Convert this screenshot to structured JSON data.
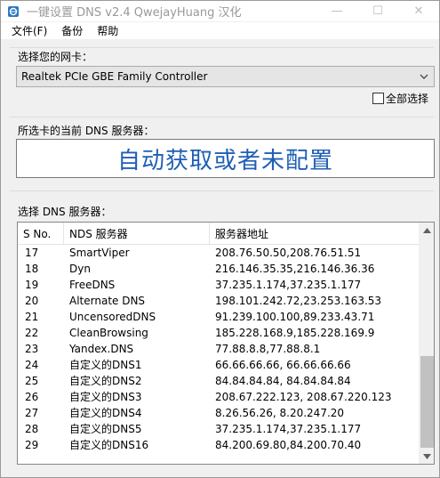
{
  "window": {
    "title": "一键设置 DNS v2.4 QwejayHuang 汉化",
    "controls": {
      "minimize": "—",
      "maximize": "☐",
      "close": "✕"
    }
  },
  "menu": [
    "文件(F)",
    "备份",
    "帮助"
  ],
  "adapter": {
    "label": "选择您的网卡：",
    "selected": "Realtek PCIe GBE Family Controller",
    "select_all": "全部选择"
  },
  "current_dns": {
    "label": "所选卡的当前 DNS 服务器：",
    "value": "自动获取或者未配置"
  },
  "dns_list": {
    "label": "选择 DNS 服务器：",
    "columns": [
      "S No.",
      "NDS 服务器",
      "服务器地址"
    ],
    "rows": [
      [
        "17",
        "SmartViper",
        "208.76.50.50,208.76.51.51"
      ],
      [
        "18",
        "Dyn",
        "216.146.35.35,216.146.36.36"
      ],
      [
        "19",
        "FreeDNS",
        "37.235.1.174,37.235.1.177"
      ],
      [
        "20",
        "Alternate DNS",
        "198.101.242.72,23.253.163.53"
      ],
      [
        "21",
        "UncensoredDNS",
        "91.239.100.100,89.233.43.71"
      ],
      [
        "22",
        "CleanBrowsing",
        "185.228.168.9,185.228.169.9"
      ],
      [
        "23",
        "Yandex.DNS",
        "77.88.8.8,77.88.8.1"
      ],
      [
        "24",
        "自定义的DNS1",
        "66.66.66.66, 66.66.66.66"
      ],
      [
        "25",
        "自定义的DNS2",
        "84.84.84.84, 84.84.84.84"
      ],
      [
        "26",
        "自定义的DNS3",
        "208.67.222.123, 208.67.220.123"
      ],
      [
        "27",
        "自定义的DNS4",
        "8.26.56.26, 8.20.247.20"
      ],
      [
        "28",
        "自定义的DNS5",
        "37.235.1.174,37.235.1.177"
      ],
      [
        "29",
        "自定义的DNS16",
        "84.200.69.80,84.200.70.40"
      ]
    ]
  }
}
